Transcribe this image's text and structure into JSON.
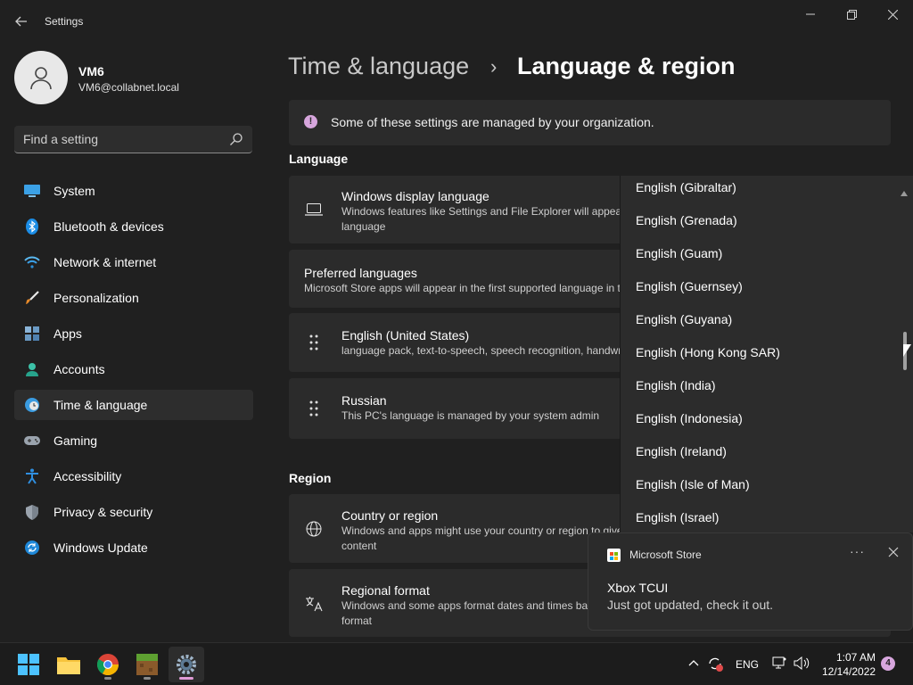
{
  "window": {
    "title": "Settings",
    "back_icon": "back-arrow-icon"
  },
  "user": {
    "name": "VM6",
    "email": "VM6@collabnet.local"
  },
  "search": {
    "placeholder": "Find a setting",
    "value": ""
  },
  "sidebar": {
    "items": [
      {
        "label": "System",
        "icon": "system-icon"
      },
      {
        "label": "Bluetooth & devices",
        "icon": "bluetooth-icon"
      },
      {
        "label": "Network & internet",
        "icon": "network-icon"
      },
      {
        "label": "Personalization",
        "icon": "brush-icon"
      },
      {
        "label": "Apps",
        "icon": "apps-icon"
      },
      {
        "label": "Accounts",
        "icon": "accounts-icon"
      },
      {
        "label": "Time & language",
        "icon": "time-language-icon",
        "active": true
      },
      {
        "label": "Gaming",
        "icon": "gaming-icon"
      },
      {
        "label": "Accessibility",
        "icon": "accessibility-icon"
      },
      {
        "label": "Privacy & security",
        "icon": "shield-icon"
      },
      {
        "label": "Windows Update",
        "icon": "update-icon"
      }
    ]
  },
  "breadcrumb": {
    "parent": "Time & language",
    "separator": "›",
    "current": "Language & region"
  },
  "info_bar": {
    "text": "Some of these settings are managed by your organization."
  },
  "language": {
    "heading": "Language",
    "display": {
      "title": "Windows display language",
      "desc_line1": "Windows features like Settings and File Explorer will appear in this",
      "desc_line2": "language"
    },
    "preferred": {
      "title": "Preferred languages",
      "desc": "Microsoft Store apps will appear in the first supported language in this list"
    },
    "langs": [
      {
        "title": "English (United States)",
        "desc": "language pack, text-to-speech, speech recognition, handwriting, basic typing"
      },
      {
        "title": "Russian",
        "desc": "This PC's language is managed by your system admin"
      }
    ]
  },
  "region": {
    "heading": "Region",
    "country": {
      "title": "Country or region",
      "desc_line1": "Windows and apps might use your country or region to give you local",
      "desc_line2": "content"
    },
    "format": {
      "title": "Regional format",
      "desc_line1": "Windows and some apps format dates and times based on your regional",
      "desc_line2": "format"
    }
  },
  "dropdown": {
    "partial_top": "English (Gibraltar)",
    "items": [
      "English (Grenada)",
      "English (Guam)",
      "English (Guernsey)",
      "English (Guyana)",
      "English (Hong Kong SAR)",
      "English (India)",
      "English (Indonesia)",
      "English (Ireland)",
      "English (Isle of Man)",
      "English (Israel)"
    ]
  },
  "toast": {
    "app": "Microsoft Store",
    "more": "···",
    "title": "Xbox TCUI",
    "body": "Just got updated, check it out."
  },
  "taskbar": {
    "apps": [
      "windows-start-icon",
      "file-explorer-icon",
      "chrome-icon",
      "minecraft-icon",
      "settings-icon"
    ],
    "lang": "ENG",
    "time": "1:07 AM",
    "date": "12/14/2022",
    "notifications": "4"
  },
  "colors": {
    "background": "#202020",
    "card": "#2b2b2b",
    "accent": "#e09bd6"
  }
}
